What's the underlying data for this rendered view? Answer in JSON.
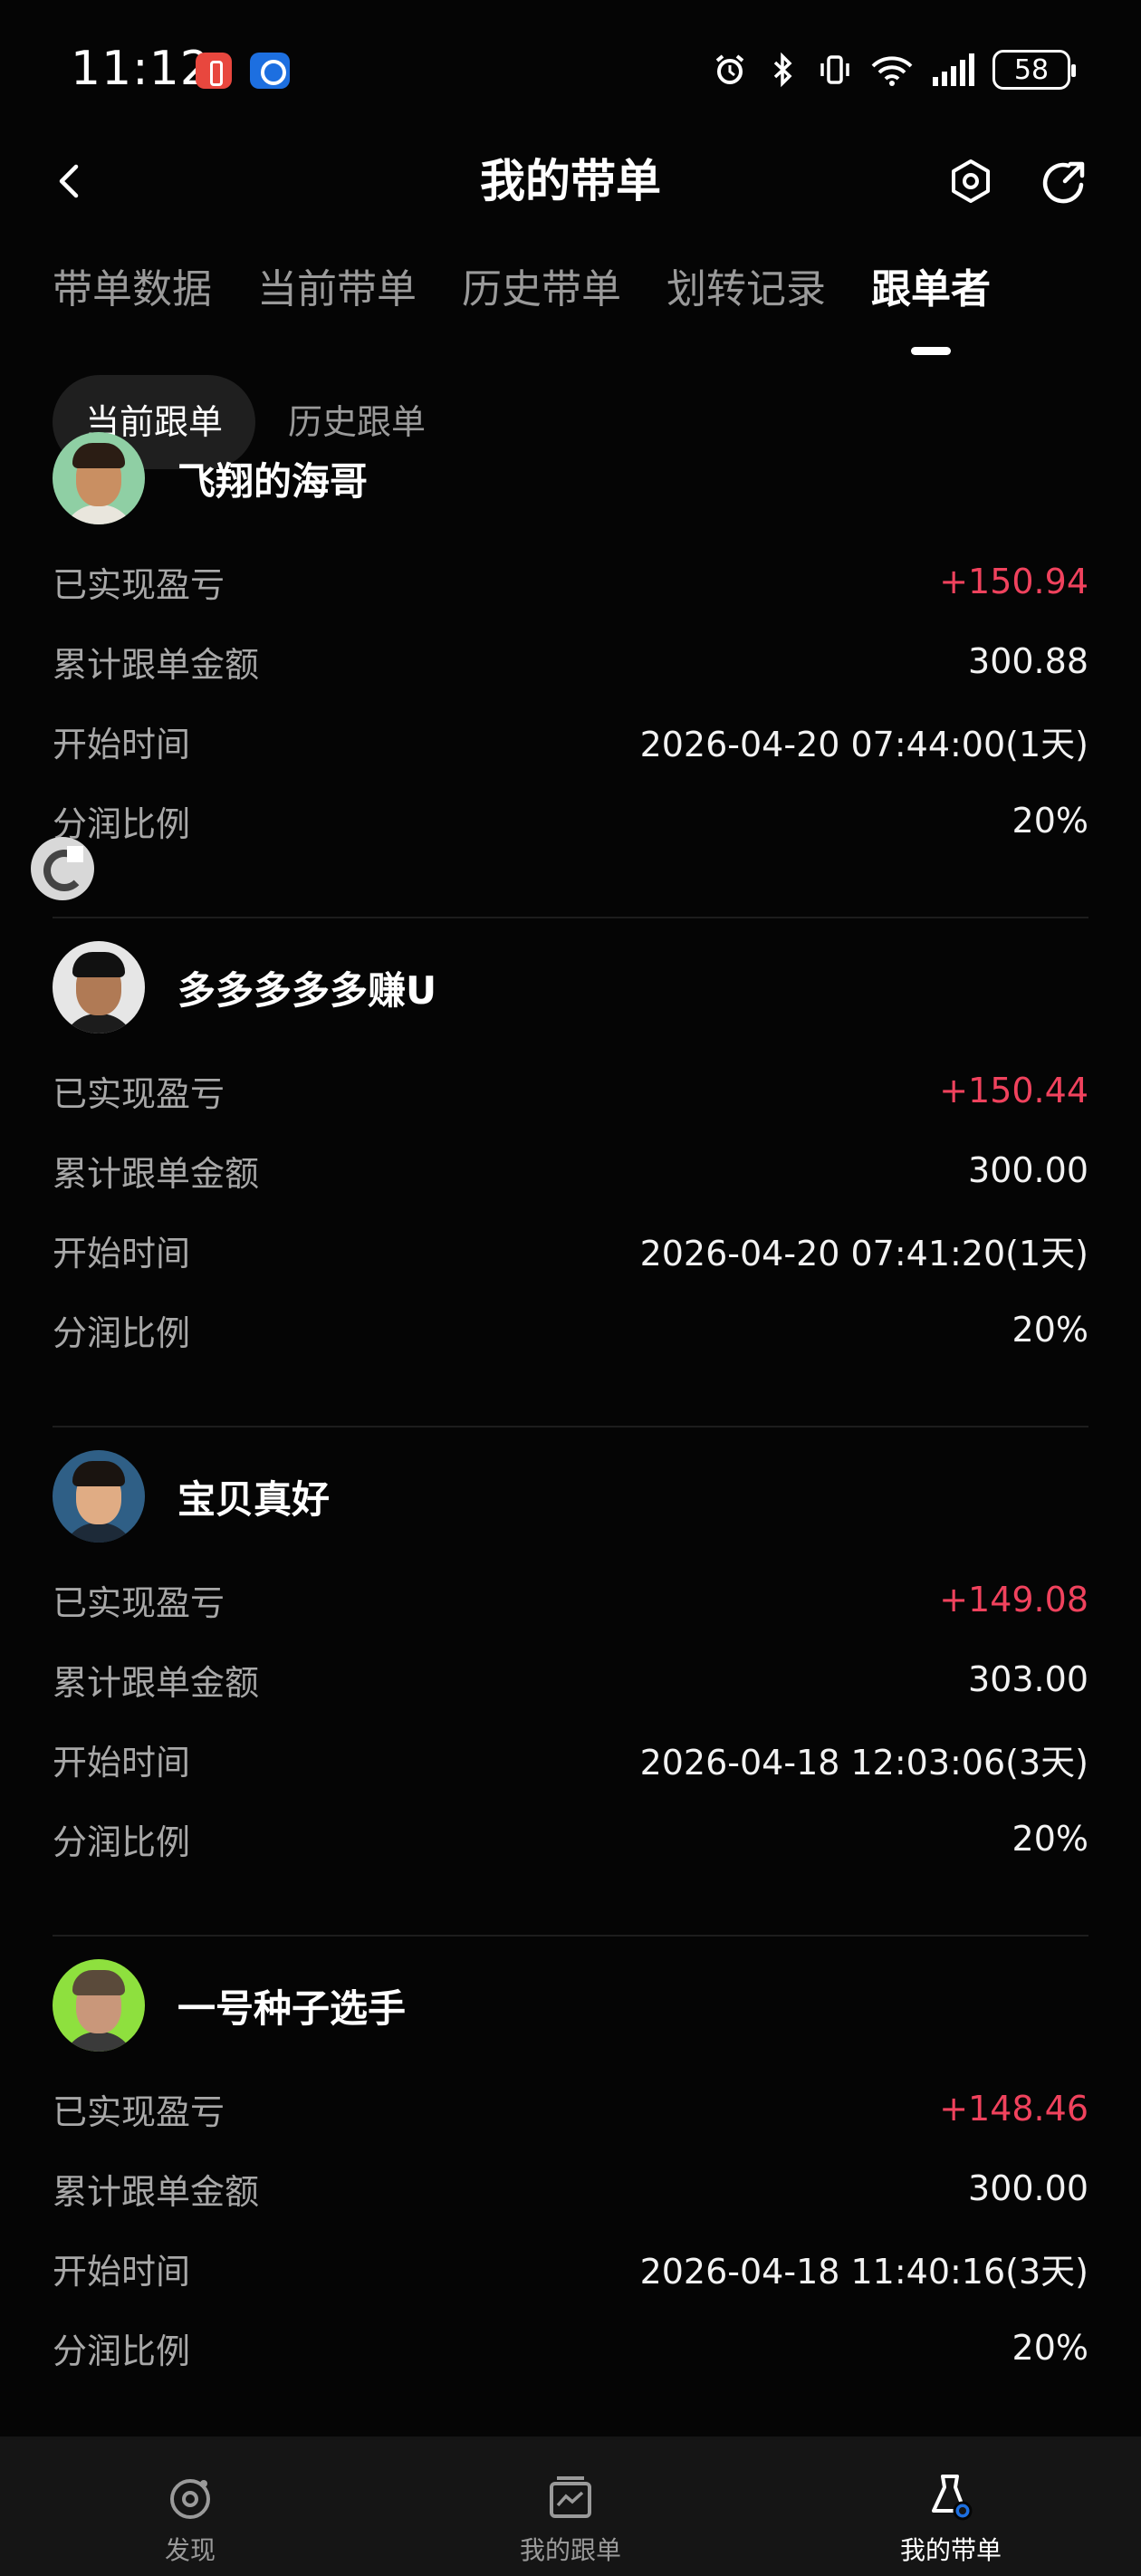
{
  "status_bar": {
    "time": "11:12",
    "battery": "58"
  },
  "header": {
    "title": "我的带单"
  },
  "tabs": [
    {
      "label": "带单数据",
      "active": false
    },
    {
      "label": "当前带单",
      "active": false
    },
    {
      "label": "历史带单",
      "active": false
    },
    {
      "label": "划转记录",
      "active": false
    },
    {
      "label": "跟单者",
      "active": true
    }
  ],
  "subtabs": [
    {
      "label": "当前跟单",
      "active": true
    },
    {
      "label": "历史跟单",
      "active": false
    }
  ],
  "labels": {
    "realized_pnl": "已实现盈亏",
    "total_amount": "累计跟单金额",
    "start_time": "开始时间",
    "share_ratio": "分润比例"
  },
  "followers": [
    {
      "name": "飞翔的海哥",
      "realized_pnl": "+150.94",
      "total_amount": "300.88",
      "start_time": "2026-04-20 07:44:00(1天)",
      "share_ratio": "20%",
      "avatar_bg": "#8fcfa4"
    },
    {
      "name": "多多多多多赚U",
      "realized_pnl": "+150.44",
      "total_amount": "300.00",
      "start_time": "2026-04-20 07:41:20(1天)",
      "share_ratio": "20%",
      "avatar_bg": "#e6e6e6"
    },
    {
      "name": "宝贝真好",
      "realized_pnl": "+149.08",
      "total_amount": "303.00",
      "start_time": "2026-04-18 12:03:06(3天)",
      "share_ratio": "20%",
      "avatar_bg": "#2f5f86"
    },
    {
      "name": "一号种子选手",
      "realized_pnl": "+148.46",
      "total_amount": "300.00",
      "start_time": "2026-04-18 11:40:16(3天)",
      "share_ratio": "20%",
      "avatar_bg": "#8ee03e"
    }
  ],
  "bottom_nav": [
    {
      "label": "发现",
      "icon": "discover-icon",
      "active": false
    },
    {
      "label": "我的跟单",
      "icon": "copy-trade-icon",
      "active": false
    },
    {
      "label": "我的带单",
      "icon": "lead-trade-icon",
      "active": true
    }
  ],
  "colors": {
    "pnl_positive": "#f0425d",
    "background": "#050505",
    "accent": "#1d6fe0"
  }
}
